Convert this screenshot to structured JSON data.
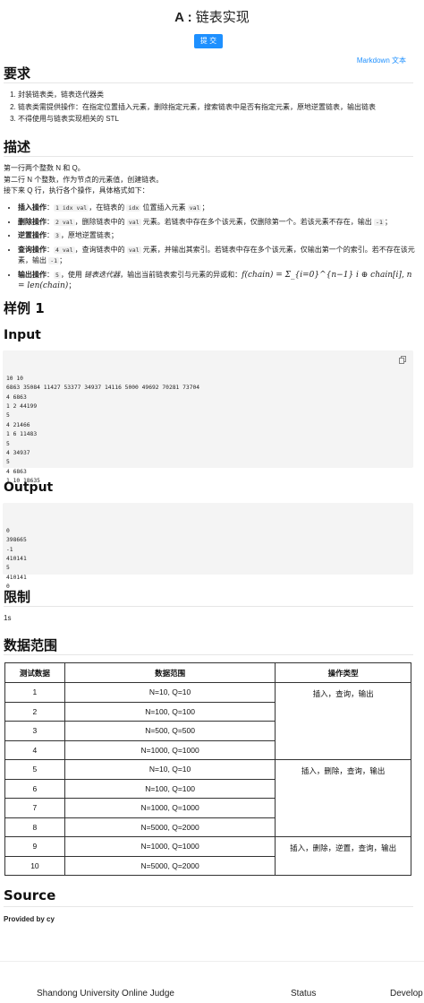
{
  "problem": {
    "title_prefix": "A :",
    "title": "链表实现",
    "submit_label": "提 交",
    "markdown_link": "Markdown 文本"
  },
  "requirements": {
    "heading": "要求",
    "items": [
      "封装链表类，链表迭代器类",
      "链表类需提供操作：在指定位置插入元素，删除指定元素，搜索链表中是否有指定元素，原地逆置链表，输出链表",
      "不得使用与链表实现相关的 STL"
    ]
  },
  "description": {
    "heading": "描述",
    "line1": "第一行两个整数 N 和 Q。",
    "line2": "第二行 N 个整数，作为节点的元素值，创建链表。",
    "line3": "接下来 Q 行，执行各个操作，具体格式如下：",
    "ops": {
      "insert": {
        "name": "插入操作",
        "sep": "：",
        "code1": "1 idx val",
        "text1": "，在链表的",
        "code2": "idx",
        "text2": "位置插入元素",
        "code3": "val",
        "text3": "；"
      },
      "delete": {
        "name": "删除操作",
        "sep": "：",
        "code1": "2 val",
        "text1": "，删除链表中的",
        "code2": "val",
        "text2": "元素。若链表中存在多个该元素，仅删除第一个。若该元素不存在，输出",
        "code3": "-1",
        "text3": "；"
      },
      "reverse": {
        "name": "逆置操作",
        "sep": "：",
        "code1": "3",
        "text1": "，原地逆置链表；"
      },
      "query": {
        "name": "查询操作",
        "sep": "：",
        "code1": "4 val",
        "text1": "，查询链表中的",
        "code2": "val",
        "text2": "元素，并输出其索引。若链表中存在多个该元素，仅输出第一个的索引。若不存在该元素，输出",
        "code3": "-1",
        "text3": "；"
      },
      "output": {
        "name": "输出操作",
        "sep": "：",
        "code1": "5",
        "text1": "，使用",
        "em": "链表迭代器",
        "text2": "，输出当前链表索引与元素的异或和：",
        "formula": "f(chain) = Σ_{i=0}^{n−1} i ⊕ chain[i], n = len(chain)",
        "text3": "；"
      }
    }
  },
  "sample": {
    "heading": "样例 1",
    "input_heading": "Input",
    "input": "10 10\n6863 35084 11427 53377 34937 14116 5000 49692 70281 73704\n4 6863\n1 2 44199\n5\n4 21466\n1 6 11483\n5\n4 34937\n5\n4 6863\n1 10 18635",
    "output_heading": "Output",
    "output": "0\n398665\n-1\n410141\n5\n410141\n0"
  },
  "limit": {
    "heading": "限制",
    "value": "1s"
  },
  "range": {
    "heading": "数据范围",
    "headers": [
      "测试数据",
      "数据范围",
      "操作类型"
    ],
    "rows": [
      {
        "id": "1",
        "range": "N=10, Q=10"
      },
      {
        "id": "2",
        "range": "N=100, Q=100"
      },
      {
        "id": "3",
        "range": "N=500, Q=500"
      },
      {
        "id": "4",
        "range": "N=1000, Q=1000"
      },
      {
        "id": "5",
        "range": "N=10, Q=10"
      },
      {
        "id": "6",
        "range": "N=100, Q=100"
      },
      {
        "id": "7",
        "range": "N=1000, Q=1000"
      },
      {
        "id": "8",
        "range": "N=5000, Q=2000"
      },
      {
        "id": "9",
        "range": "N=1000, Q=1000"
      },
      {
        "id": "10",
        "range": "N=5000, Q=2000"
      }
    ],
    "types": [
      "插入，查询，输出",
      "插入，删除，查询，输出",
      "插入，删除，逆置，查询，输出"
    ]
  },
  "source": {
    "heading": "Source",
    "provided": "Provided by cy"
  },
  "footer": {
    "site": "Shandong University Online Judge",
    "status": "Status",
    "developer": "Develop"
  },
  "icons": {
    "copy": "copy-icon"
  },
  "colors": {
    "accent": "#1e90ff",
    "code_bg": "#f4f4f4"
  }
}
